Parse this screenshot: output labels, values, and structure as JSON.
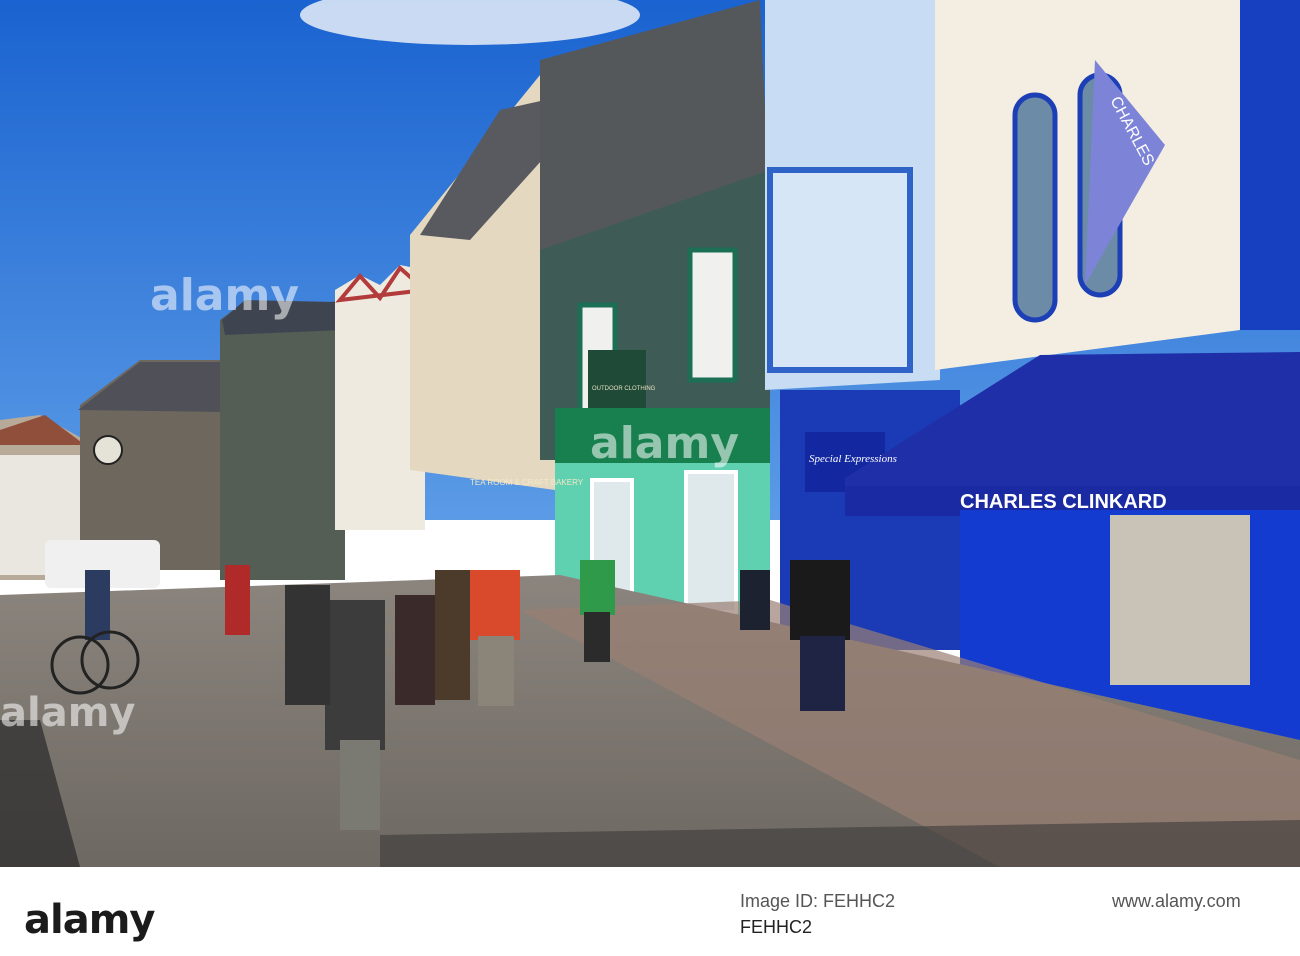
{
  "photo": {
    "signs": {
      "awning": "CHARLES CLINKARD",
      "flag": "CHARLES",
      "special_shop": "Special Expressions",
      "tea_room": "TEA ROOM & CRAFT BAKERY",
      "outdoor_sign": "OUTDOOR CLOTHING"
    }
  },
  "watermark": {
    "text": "alamy"
  },
  "footer": {
    "logo": "alamy",
    "image_id_label": "Image ID: FEHHC2",
    "url": "www.alamy.com",
    "code": "FEHHC2"
  },
  "colors": {
    "sky": "#1f6fd6",
    "awning": "#1f2fa8",
    "green_shop": "#5fd0b0",
    "pavement": "#9a8f84"
  }
}
